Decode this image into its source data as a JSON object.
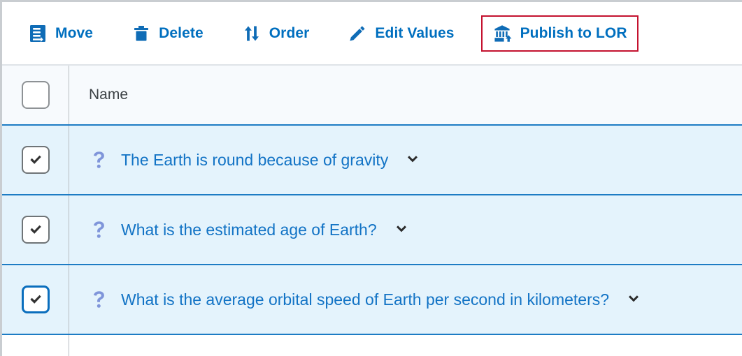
{
  "colors": {
    "accent_blue": "#006fbf",
    "link_blue": "#1273c5",
    "row_blue": "#e4f3fc",
    "header_row": "#f7fafd",
    "row_divider": "#1d7cc4",
    "highlight_red": "#c4122f",
    "question_icon": "#7f95da",
    "border_gray": "#c9cdd1"
  },
  "toolbar": {
    "buttons": [
      {
        "label": "Move",
        "icon": "move-document-icon",
        "highlighted": false
      },
      {
        "label": "Delete",
        "icon": "trash-icon",
        "highlighted": false
      },
      {
        "label": "Order",
        "icon": "sort-arrows-icon",
        "highlighted": false
      },
      {
        "label": "Edit Values",
        "icon": "pencil-icon",
        "highlighted": false
      },
      {
        "label": "Publish to LOR",
        "icon": "bank-upload-icon",
        "highlighted": true
      }
    ]
  },
  "table": {
    "header": {
      "select_all_checked": false,
      "columns": [
        {
          "label": "Name"
        }
      ]
    },
    "rows": [
      {
        "checked": true,
        "focused": false,
        "icon": "question-mark-icon",
        "name": "The Earth is round because of gravity",
        "chevron": "chevron-down-icon"
      },
      {
        "checked": true,
        "focused": false,
        "icon": "question-mark-icon",
        "name": "What is the estimated age of Earth?",
        "chevron": "chevron-down-icon"
      },
      {
        "checked": true,
        "focused": true,
        "icon": "question-mark-icon",
        "name": "What is the average orbital speed of Earth per second in kilometers?",
        "chevron": "chevron-down-icon"
      }
    ]
  }
}
